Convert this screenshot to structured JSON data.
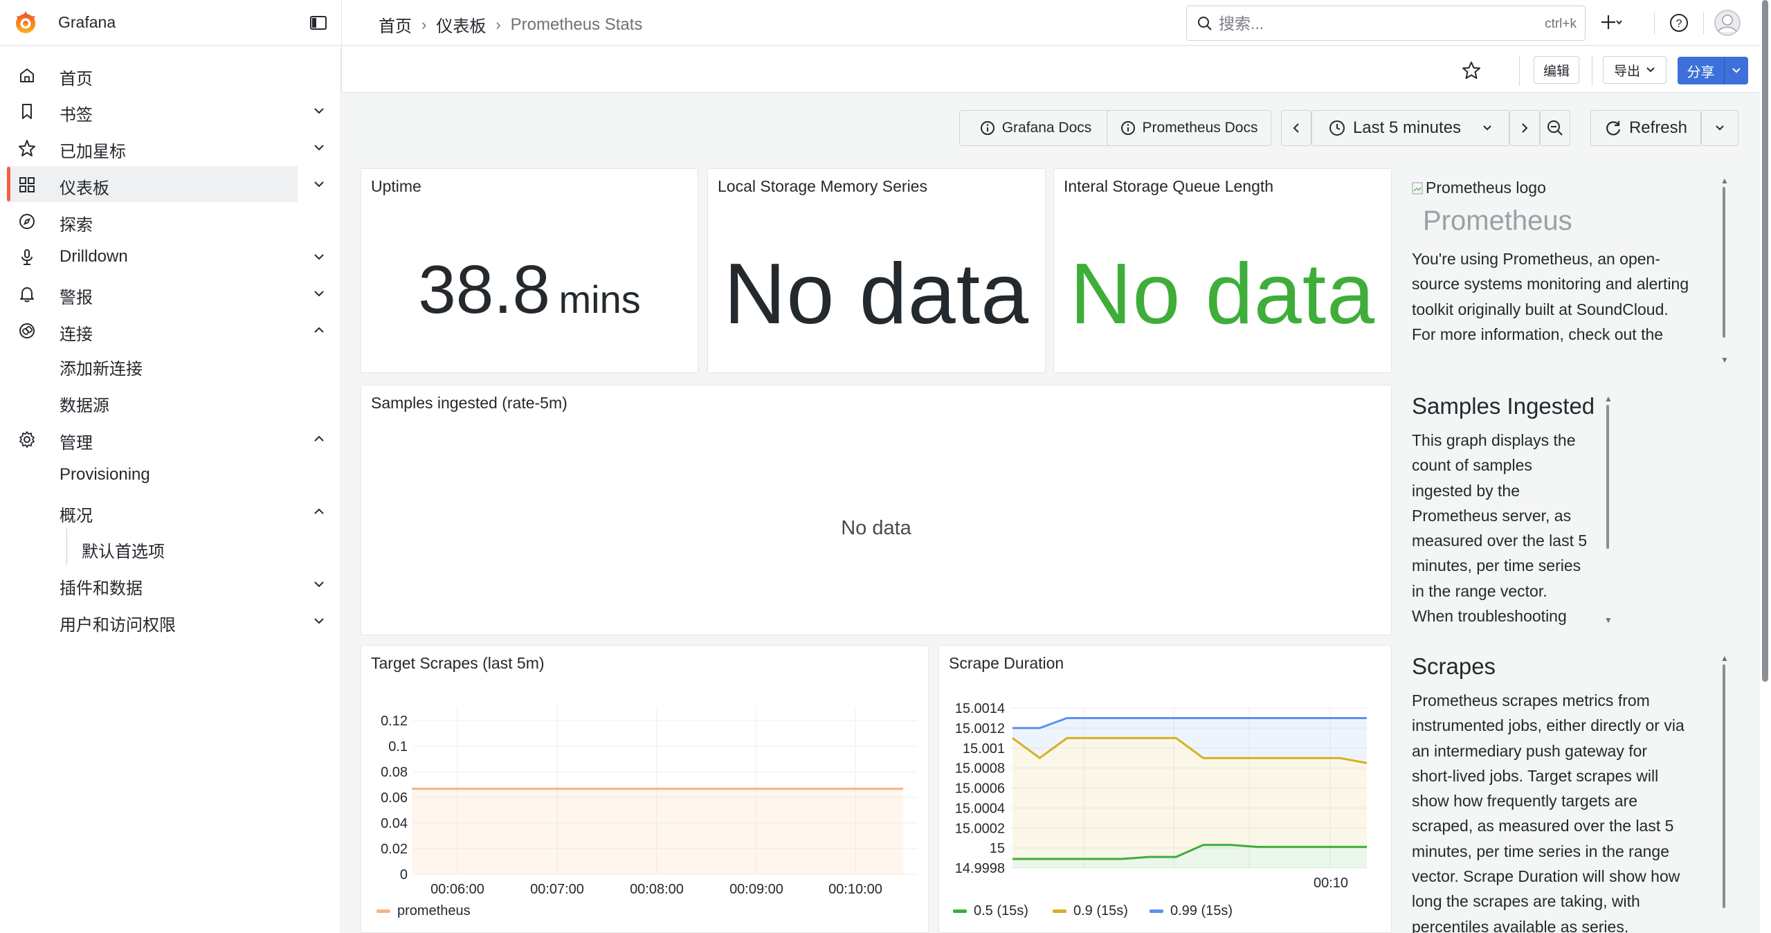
{
  "app": {
    "brand": "Grafana",
    "accent_color": "#f55f3e"
  },
  "breadcrumb": {
    "items": [
      "首页",
      "仪表板"
    ],
    "separator": "›",
    "current": "Prometheus Stats"
  },
  "search": {
    "placeholder": "搜索...",
    "shortcut": "ctrl+k"
  },
  "toolbar": {
    "edit_label": "编辑",
    "export_label": "导出",
    "share_label": "分享"
  },
  "sidebar": {
    "items": [
      {
        "label": "首页",
        "icon": "home-icon"
      },
      {
        "label": "书签",
        "icon": "bookmark-icon"
      },
      {
        "label": "已加星标",
        "icon": "star-icon"
      },
      {
        "label": "仪表板",
        "icon": "dashboards-icon"
      },
      {
        "label": "探索",
        "icon": "compass-icon"
      },
      {
        "label": "Drilldown",
        "icon": "drilldown-icon"
      },
      {
        "label": "警报",
        "icon": "bell-icon"
      },
      {
        "label": "连接",
        "icon": "connections-icon"
      },
      {
        "label": "管理",
        "icon": "gear-icon"
      }
    ],
    "connections_children": [
      "添加新连接",
      "数据源"
    ],
    "admin_children": [
      "Provisioning",
      "概况",
      "插件和数据",
      "用户和访问权限"
    ],
    "overview_children": [
      "默认首选项"
    ]
  },
  "time_controls": {
    "grafana_docs": "Grafana Docs",
    "prometheus_docs": "Prometheus Docs",
    "range": "Last 5 minutes",
    "refresh": "Refresh"
  },
  "panels": {
    "uptime": {
      "title": "Uptime",
      "value": "38.8",
      "unit": "mins"
    },
    "local_storage": {
      "title": "Local Storage Memory Series",
      "value": "No data",
      "color": "#24292e"
    },
    "queue_length": {
      "title": "Interal Storage Queue Length",
      "value": "No data",
      "color": "#3fad3a"
    },
    "samples": {
      "title": "Samples ingested (rate-5m)",
      "value": "No data"
    },
    "target_scrapes": {
      "title": "Target Scrapes (last 5m)"
    },
    "scrape_duration": {
      "title": "Scrape Duration"
    }
  },
  "text_panels": {
    "prometheus": {
      "logo_alt": "Prometheus logo",
      "heading": "Prometheus",
      "lines": [
        "You're using Prometheus, an open-",
        "source systems monitoring and alerting",
        "toolkit originally built at SoundCloud.",
        "For more information, check out the"
      ]
    },
    "samples": {
      "heading": "Samples Ingested",
      "lines": [
        "This graph displays the",
        "count of samples",
        "ingested by the",
        "Prometheus server, as",
        "measured over the last 5",
        "minutes, per time series",
        "in the range vector.",
        "When troubleshooting"
      ]
    },
    "scrapes": {
      "heading": "Scrapes",
      "lines": [
        "Prometheus scrapes metrics from",
        "instrumented jobs, either directly or via",
        "an intermediary push gateway for",
        "short-lived jobs. Target scrapes will",
        "show how frequently targets are",
        "scraped, as measured over the last 5",
        "minutes, per time series in the range",
        "vector. Scrape Duration will show how",
        "long the scrapes are taking, with",
        "percentiles available as series."
      ]
    }
  },
  "chart_data": [
    {
      "type": "line",
      "title": "Target Scrapes (last 5m)",
      "x": [
        "00:06:00",
        "00:07:00",
        "00:08:00",
        "00:09:00",
        "00:10:00"
      ],
      "yticks": [
        "0.12",
        "0.1",
        "0.08",
        "0.06",
        "0.04",
        "0.02",
        "0"
      ],
      "ylim": [
        0,
        0.12
      ],
      "series": [
        {
          "name": "prometheus",
          "color": "#f9b27d",
          "values": [
            0.0667,
            0.0667,
            0.0667,
            0.0667,
            0.0667,
            0.0667
          ]
        }
      ],
      "grid": true,
      "legend": "bottom-left"
    },
    {
      "type": "line",
      "title": "Scrape Duration",
      "x": [
        "00:10"
      ],
      "yticks": [
        "15.0014",
        "15.0012",
        "15.001",
        "15.0008",
        "15.0006",
        "15.0004",
        "15.0002",
        "15",
        "14.9998"
      ],
      "ylim": [
        14.9998,
        15.0014
      ],
      "series": [
        {
          "name": "0.5 (15s)",
          "color": "#3fad3a",
          "values": [
            14.99989,
            14.99989,
            14.99989,
            14.99989,
            14.99989,
            14.99991,
            14.99991,
            15.00003,
            15.00003,
            15.00001,
            15.00001,
            15.00001,
            15.00001,
            15.00001
          ]
        },
        {
          "name": "0.9 (15s)",
          "color": "#d6b01e",
          "values": [
            15.0011,
            15.0009,
            15.0011,
            15.0011,
            15.0011,
            15.0011,
            15.0011,
            15.0009,
            15.0009,
            15.0009,
            15.0009,
            15.0009,
            15.0009,
            15.00085
          ]
        },
        {
          "name": "0.99 (15s)",
          "color": "#5b8ff0",
          "values": [
            15.0012,
            15.0012,
            15.0013,
            15.0013,
            15.0013,
            15.0013,
            15.0013,
            15.0013,
            15.0013,
            15.0013,
            15.0013,
            15.0013,
            15.0013,
            15.0013
          ]
        }
      ],
      "grid": true,
      "legend": "bottom-left"
    }
  ]
}
